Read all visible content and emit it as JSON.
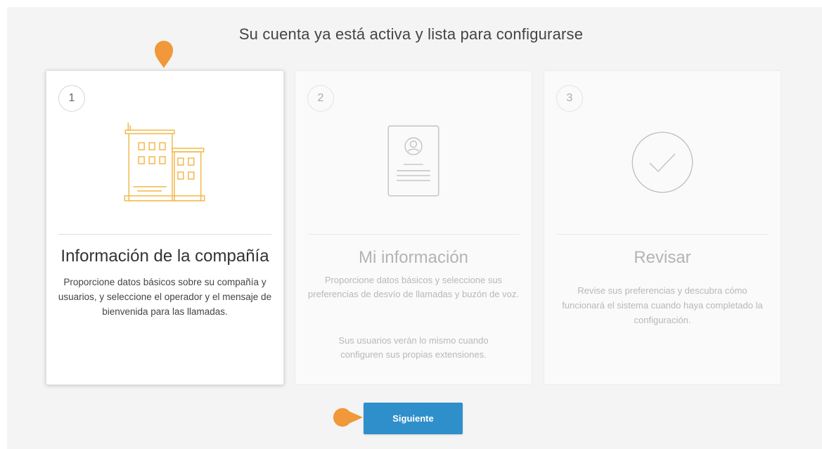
{
  "header": {
    "title": "Su cuenta ya está activa y lista para configurarse"
  },
  "steps": [
    {
      "number": "1",
      "title": "Información de la compañía",
      "description": "Proporcione datos básicos sobre su compañía y usuarios, y seleccione el operador y el mensaje de bienvenida para las llamadas.",
      "icon": "building-icon",
      "active": true
    },
    {
      "number": "2",
      "title": "Mi información",
      "description": "Proporcione datos básicos y seleccione sus preferencias de desvío de llamadas y buzón de voz.",
      "note": "Sus usuarios verán lo mismo cuando configuren sus propias extensiones.",
      "icon": "profile-card-icon",
      "active": false
    },
    {
      "number": "3",
      "title": "Revisar",
      "description": "Revise sus preferencias y descubra cómo funcionará el sistema cuando haya completado la configuración.",
      "icon": "checkmark-circle-icon",
      "active": false
    }
  ],
  "actions": {
    "next_label": "Siguiente"
  },
  "colors": {
    "accent_blue": "#2f8fcb",
    "marker_orange": "#f0983a",
    "building_orange": "#f2b84b"
  }
}
